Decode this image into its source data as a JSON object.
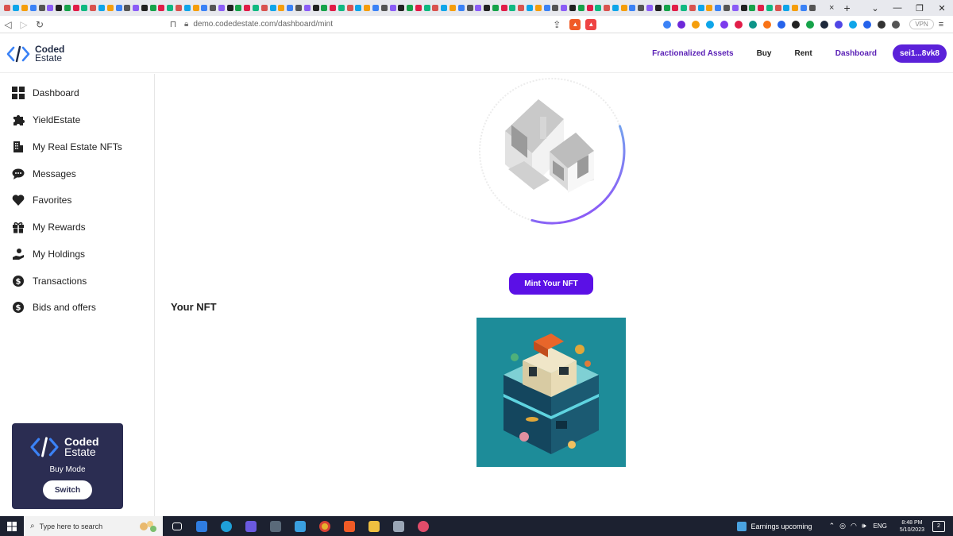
{
  "browser": {
    "url": "demo.codedestate.com/dashboard/mint",
    "vpn_label": "VPN",
    "new_tab_label": "+",
    "close_tab_label": "×"
  },
  "header": {
    "logo": {
      "line1": "Coded",
      "line2": "Estate"
    },
    "nav": [
      {
        "label": "Fractionalized Assets"
      },
      {
        "label": "Buy"
      },
      {
        "label": "Rent"
      },
      {
        "label": "Dashboard"
      }
    ],
    "wallet_label": "sei1...8vk8"
  },
  "sidebar": {
    "items": [
      {
        "label": "Dashboard",
        "icon": "grid-icon"
      },
      {
        "label": "YieldEstate",
        "icon": "puzzle-icon"
      },
      {
        "label": "My Real Estate NFTs",
        "icon": "building-icon"
      },
      {
        "label": "Messages",
        "icon": "chat-bubble-icon"
      },
      {
        "label": "Favorites",
        "icon": "heart-icon"
      },
      {
        "label": "My Rewards",
        "icon": "gift-icon"
      },
      {
        "label": "My Holdings",
        "icon": "hand-coin-icon"
      },
      {
        "label": "Transactions",
        "icon": "dollar-coin-icon"
      },
      {
        "label": "Bids and offers",
        "icon": "dollar-coin-icon"
      }
    ],
    "mode_card": {
      "logo_line1": "Coded",
      "logo_line2": "Estate",
      "mode_label": "Buy Mode",
      "switch_label": "Switch"
    }
  },
  "main": {
    "progress_fraction": 0.35,
    "mint_button_label": "Mint Your NFT",
    "your_nft_heading": "Your NFT"
  },
  "taskbar": {
    "search_placeholder": "Type here to search",
    "weather_text": "Earnings upcoming",
    "language": "ENG",
    "time": "8:48 PM",
    "date": "5/10/2023",
    "notification_count": "2"
  },
  "colors": {
    "brand_purple": "#5b21d9",
    "nav_purple": "#5b21b6",
    "mode_card_bg": "#2b2d52",
    "taskbar_bg": "#1c2130"
  }
}
